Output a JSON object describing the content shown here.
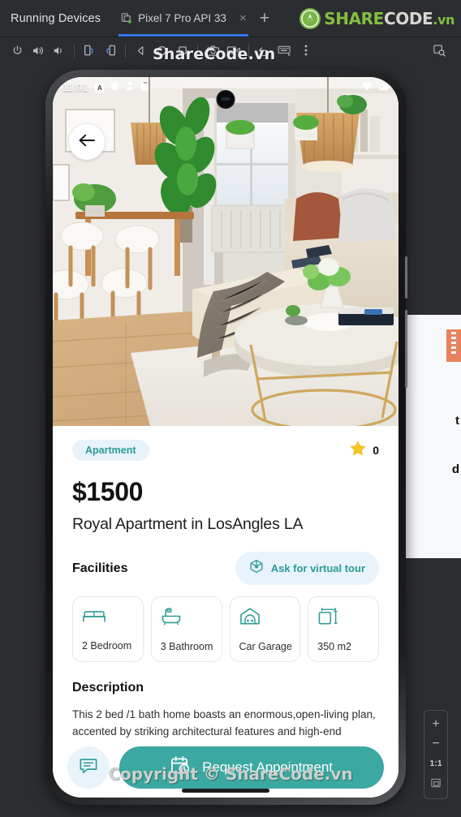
{
  "ide": {
    "title": "Running Devices",
    "tab": {
      "label": "Pixel 7 Pro API 33",
      "icon": "device-icon",
      "close_icon": "×",
      "add_icon": "+"
    },
    "logo": {
      "part1": "SHARE",
      "part2": "CODE",
      "part3": ".vn"
    },
    "watermark_top": "ShareCode.vn",
    "watermark_bottom": "Copyright © ShareCode.vn",
    "toolbar": [
      {
        "name": "power-button",
        "title": "Power"
      },
      {
        "name": "volume-up-button",
        "title": "Volume Up"
      },
      {
        "name": "volume-down-button",
        "title": "Volume Down"
      },
      {
        "name": "rotate-left-button",
        "title": "Rotate Left"
      },
      {
        "name": "rotate-right-button",
        "title": "Rotate Right"
      },
      {
        "name": "back-nav-button",
        "title": "Back"
      },
      {
        "name": "home-nav-button",
        "title": "Home"
      },
      {
        "name": "overview-nav-button",
        "title": "Overview"
      },
      {
        "name": "screenshot-button",
        "title": "Take Screenshot"
      },
      {
        "name": "record-button",
        "title": "Record Screen"
      },
      {
        "name": "undo-button",
        "title": "Undo"
      },
      {
        "name": "keyboard-button",
        "title": "Hardware Input"
      },
      {
        "name": "more-options-button",
        "title": "More"
      }
    ],
    "zoom_controls": {
      "zoom_in": "+",
      "zoom_out": "−",
      "actual_size": "1:1",
      "fit_icon": "fit-to-screen-icon"
    }
  },
  "phone": {
    "status_bar": {
      "time": "11:01",
      "icons": [
        "a-badge-icon",
        "shield-icon",
        "location-sharing-icon",
        "sd-card-icon"
      ],
      "right_icons": [
        "wifi-icon",
        "signal-icon"
      ]
    },
    "back_button": "back-arrow-icon",
    "hero_alt": "apartment-living-room-photo"
  },
  "listing": {
    "badge": "Apartment",
    "rating_icon": "star-icon",
    "rating_value": "0",
    "price": "$1500",
    "title": "Royal Apartment in LosAngles LA",
    "facilities_heading": "Facilities",
    "virtual_tour": {
      "label": "Ask for virtual tour",
      "icon": "cube-3d-icon"
    },
    "facilities": [
      {
        "icon": "bed-icon",
        "label": "2 Bedroom"
      },
      {
        "icon": "bathtub-icon",
        "label": "3 Bathroom"
      },
      {
        "icon": "garage-icon",
        "label": "Car Garage"
      },
      {
        "icon": "area-icon",
        "label": "350 m2"
      }
    ],
    "description_heading": "Description",
    "description_body": "This 2 bed /1 bath home boasts an enormous,open-living plan, accented by striking architectural features and high-end finishes. Feel inspired by open sight lines that",
    "chat_button_icon": "chat-bubble-icon",
    "cta": {
      "label": "Request Appointment",
      "icon": "calendar-clock-icon"
    }
  },
  "peek_panel": {
    "text_top": "t",
    "text_bottom": "d"
  },
  "colors": {
    "accent_teal": "#3ba8a1",
    "badge_bg": "#e8f2fb",
    "badge_text": "#2b9b96",
    "star": "#f6c228",
    "tab_underline": "#3574f0",
    "ide_bg": "#2b2d30",
    "logo_green": "#84bf41"
  }
}
